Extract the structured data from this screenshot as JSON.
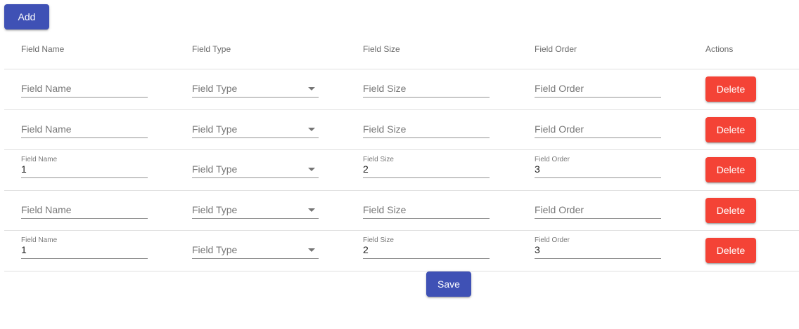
{
  "toolbar": {
    "add_label": "Add"
  },
  "table": {
    "headers": [
      "Field Name",
      "Field Type",
      "Field Size",
      "Field Order",
      "Actions"
    ],
    "rows": [
      {
        "name": "",
        "type": "",
        "size": "",
        "order": ""
      },
      {
        "name": "",
        "type": "",
        "size": "",
        "order": ""
      },
      {
        "name": "1",
        "type": "",
        "size": "2",
        "order": "3"
      },
      {
        "name": "",
        "type": "",
        "size": "",
        "order": ""
      },
      {
        "name": "1",
        "type": "",
        "size": "2",
        "order": "3"
      }
    ],
    "placeholders": {
      "name": "Field Name",
      "type": "Field Type",
      "size": "Field Size",
      "order": "Field Order"
    },
    "delete_label": "Delete"
  },
  "footer": {
    "save_label": "Save"
  },
  "colors": {
    "primary": "#3f51b5",
    "danger": "#f44336"
  }
}
